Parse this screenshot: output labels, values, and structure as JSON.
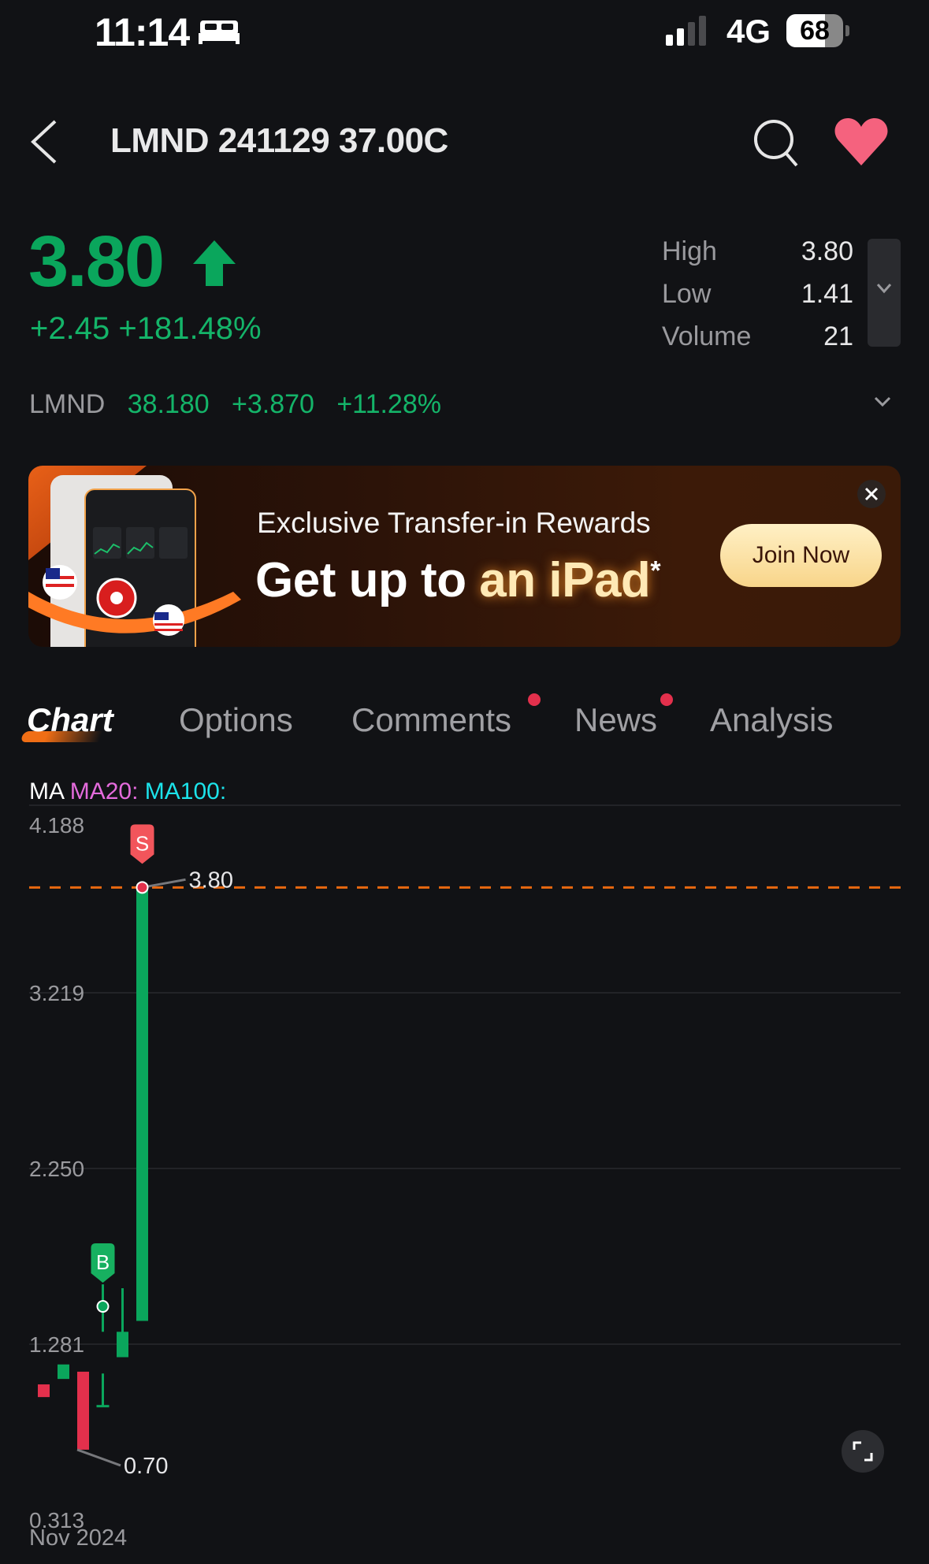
{
  "status_bar": {
    "time": "11:14",
    "network": "4G",
    "battery": "68",
    "battery_level": 0.68,
    "icons": [
      "bed-icon",
      "signal-icon"
    ]
  },
  "header": {
    "title": "LMND 241129 37.00C",
    "icons": [
      "back-icon",
      "search-icon",
      "heart-icon"
    ]
  },
  "quote": {
    "price": "3.80",
    "change": "+2.45",
    "change_pct": "+181.48%",
    "stats": [
      {
        "label": "High",
        "value": "3.80"
      },
      {
        "label": "Low",
        "value": "1.41"
      },
      {
        "label": "Volume",
        "value": "21"
      }
    ]
  },
  "underlying": {
    "symbol": "LMND",
    "price": "38.180",
    "change": "+3.870",
    "change_pct": "+11.28%"
  },
  "banner": {
    "subtitle": "Exclusive Transfer-in Rewards",
    "headline_1": "Get up to ",
    "headline_2": "an iPad",
    "headline_mark": "*",
    "cta": "Join Now"
  },
  "tabs": [
    {
      "label": "Chart",
      "active": true,
      "badge": false
    },
    {
      "label": "Options",
      "active": false,
      "badge": false
    },
    {
      "label": "Comments",
      "active": false,
      "badge": true
    },
    {
      "label": "News",
      "active": false,
      "badge": true
    },
    {
      "label": "Analysis",
      "active": false,
      "badge": false
    }
  ],
  "ma_legend": {
    "ma": "MA",
    "ma20": "MA20:",
    "ma100": "MA100:"
  },
  "colors": {
    "up": "#0aa65c",
    "down": "#e3304c",
    "last_price_line": "#e8680f",
    "ma20": "#e46bdc",
    "ma100": "#1ce3ea"
  },
  "chart_data": {
    "type": "candlestick",
    "title": "",
    "xlabel": "Nov 2024",
    "ylabel": "",
    "ylim": [
      0.313,
      4.188
    ],
    "yticks": [
      "4.188",
      "3.219",
      "2.250",
      "1.281",
      "0.313"
    ],
    "grid": true,
    "candles": [
      {
        "open": 1.06,
        "close": 0.99,
        "high": 1.06,
        "low": 0.99
      },
      {
        "open": 1.09,
        "close": 1.17,
        "high": 1.17,
        "low": 1.09
      },
      {
        "open": 1.13,
        "close": 0.7,
        "high": 1.13,
        "low": 0.7
      },
      {
        "open": 0.94,
        "close": 0.94,
        "high": 1.12,
        "low": 0.94
      },
      {
        "open": 1.21,
        "close": 1.35,
        "high": 1.59,
        "low": 1.21
      },
      {
        "open": 1.41,
        "close": 3.8,
        "high": 3.8,
        "low": 1.41
      }
    ],
    "last_price": 3.8,
    "annotations": [
      {
        "label": "3.80",
        "candle": 5,
        "value": 3.8,
        "kind": "high"
      },
      {
        "label": "0.70",
        "candle": 2,
        "value": 0.7,
        "kind": "low"
      }
    ],
    "trade_markers": [
      {
        "label": "B",
        "candle": 4,
        "value": 1.49,
        "side": "buy"
      },
      {
        "label": "S",
        "candle": 5,
        "value": 3.8,
        "side": "sell"
      }
    ]
  }
}
